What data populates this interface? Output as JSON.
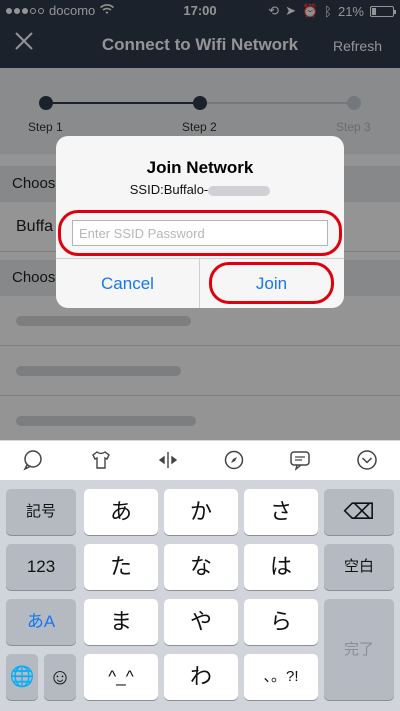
{
  "status_bar": {
    "carrier": "docomo",
    "time": "17:00",
    "battery_percent": "21%",
    "battery_level": 0.21
  },
  "nav": {
    "title": "Connect to Wifi Network",
    "refresh": "Refresh",
    "close_icon": "close-icon"
  },
  "steps": [
    {
      "label": "Step 1",
      "active": true
    },
    {
      "label": "Step 2",
      "active": true
    },
    {
      "label": "Step 3",
      "active": false
    }
  ],
  "background_list": {
    "section_1": "Choos",
    "selected_network": "Buffa",
    "section_2": "Choos",
    "rows": [
      "",
      "",
      ""
    ]
  },
  "dialog": {
    "title": "Join Network",
    "ssid_prefix": "SSID:Buffalo-",
    "password_placeholder": "Enter SSID Password",
    "password_value": "",
    "cancel": "Cancel",
    "join": "Join"
  },
  "highlight_color": "#e0000c",
  "keyboard": {
    "toolbar_icons": [
      "speech-bubble-icon",
      "tshirt-icon",
      "cursor-move-icon",
      "compass-icon",
      "chat-icon",
      "chevron-down-icon"
    ],
    "left_keys": [
      "記号",
      "123",
      "あA"
    ],
    "rows": [
      [
        "あ",
        "か",
        "さ"
      ],
      [
        "た",
        "な",
        "は"
      ],
      [
        "ま",
        "や",
        "ら"
      ],
      [
        "^_^",
        "わ",
        "、。?!"
      ]
    ],
    "right_keys": [
      "⌫",
      "空白",
      "完了"
    ],
    "globe": "🌐",
    "emoji": "☺"
  }
}
